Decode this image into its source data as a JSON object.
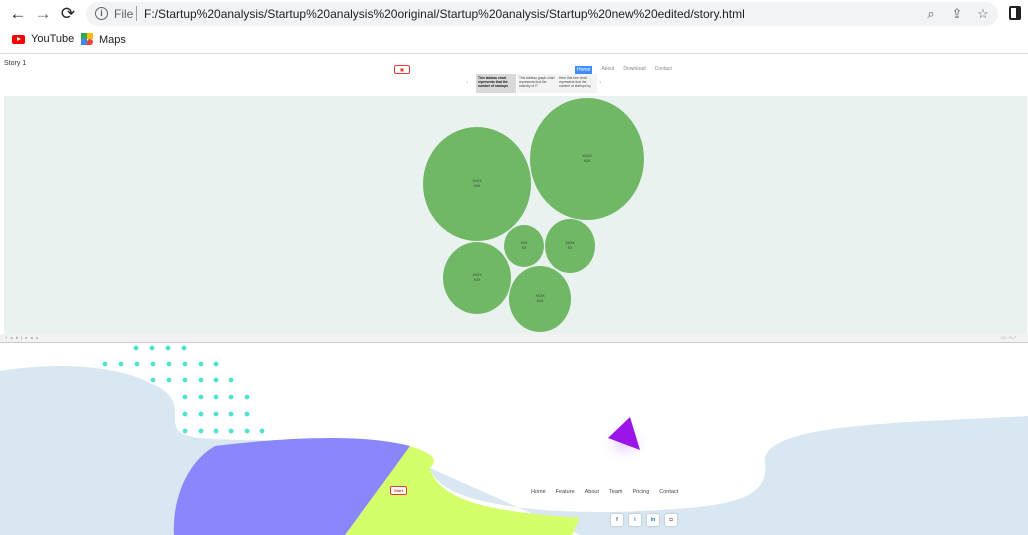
{
  "browser": {
    "back_icon": "arrow-left-icon",
    "forward_icon": "arrow-right-icon",
    "reload_icon": "reload-icon",
    "scheme_label": "File",
    "url": "F:/Startup%20analysis/Startup%20analysis%20original/Startup%20analysis/Startup%20new%20edited/story.html",
    "bookmarks": [
      {
        "label": "YouTube",
        "icon": "youtube-icon"
      },
      {
        "label": "Maps",
        "icon": "maps-icon"
      }
    ]
  },
  "story": {
    "title": "Story 1",
    "nav": [
      "Home",
      "About",
      "Download",
      "Contact"
    ],
    "points": [
      "This tableau chart represents that the number of startups",
      "This tableau graph chart represents that the industry of IT",
      "Here this tree chart represents that the number of startups by"
    ]
  },
  "viz": {
    "fill_color": "#70b866",
    "background_color": "#e9f2ef",
    "bubbles": [
      {
        "line1": "XXXX",
        "line2": "XXX"
      },
      {
        "line1": "XXXX",
        "line2": "XXX"
      },
      {
        "line1": "XXX",
        "line2": "XX"
      },
      {
        "line1": "XXXX",
        "line2": "XX"
      },
      {
        "line1": "XXXX",
        "line2": "XXX"
      },
      {
        "line1": "XXXX",
        "line2": "XXX"
      }
    ],
    "toolbar_label": "+ a b | e a u",
    "toolbar_controls": "◁ ▷ ⟲ ⤢"
  },
  "footer": {
    "logo_text": "Start",
    "nav": [
      "Home",
      "Feature",
      "About",
      "Team",
      "Pricing",
      "Contact"
    ],
    "social": [
      {
        "icon": "facebook-icon",
        "glyph": "f",
        "color": "#3b5998"
      },
      {
        "icon": "twitter-icon",
        "glyph": "t",
        "color": "#1da1f2"
      },
      {
        "icon": "linkedin-icon",
        "glyph": "in",
        "color": "#0077b5"
      },
      {
        "icon": "instagram-icon",
        "glyph": "◘",
        "color": "#333333"
      }
    ],
    "colors": {
      "wave": "#d9e7f2",
      "dots": "#4fe3d3",
      "purple": "#8a86fb",
      "lime": "#d4ff6a",
      "triangle": "#9b14e8"
    }
  }
}
